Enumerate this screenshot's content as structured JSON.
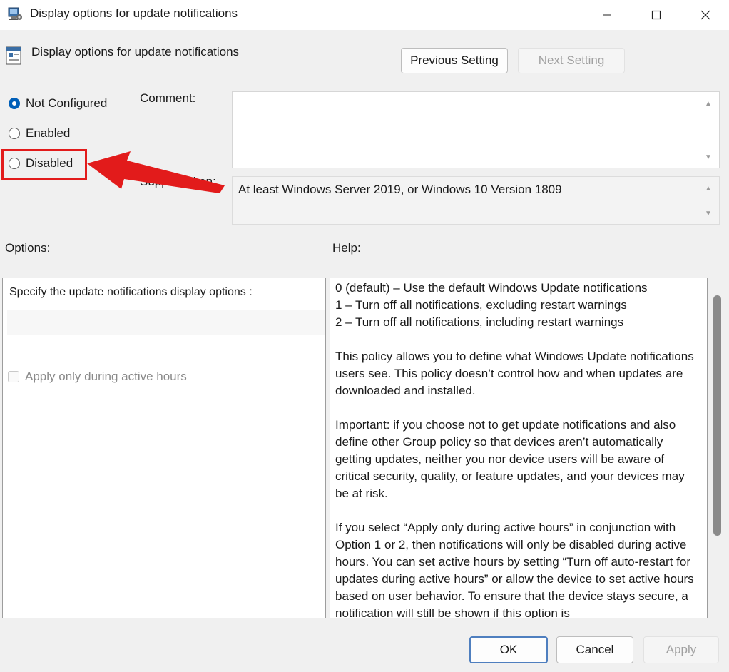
{
  "window": {
    "title": "Display options for update notifications",
    "icon": "group-policy-icon",
    "controls": {
      "minimize": "—",
      "maximize": "☐",
      "close": "✕"
    }
  },
  "header": {
    "policy_title": "Display options for update notifications",
    "previous_label": "Previous Setting",
    "next_label": "Next Setting"
  },
  "state": {
    "options": [
      {
        "label": "Not Configured",
        "checked": true
      },
      {
        "label": "Enabled",
        "checked": false
      },
      {
        "label": "Disabled",
        "checked": false
      }
    ],
    "highlight_color": "#e21b1b"
  },
  "comment": {
    "label": "Comment:",
    "value": ""
  },
  "supported": {
    "label": "Supported on:",
    "value": "At least Windows Server 2019, or Windows 10 Version 1809"
  },
  "options_panel": {
    "heading": "Options:",
    "specify_label": "Specify the update notifications display options :",
    "dropdown_value": "",
    "checkbox_label": "Apply only during active hours"
  },
  "help_panel": {
    "heading": "Help:",
    "lines": [
      "0 (default) – Use the default Windows Update notifications",
      "1 – Turn off all notifications, excluding restart warnings",
      "2 – Turn off all notifications, including restart warnings"
    ],
    "paragraphs": [
      "This policy allows you to define what Windows Update notifications users see. This policy doesn’t control how and when updates are downloaded and installed.",
      "Important: if you choose not to get update notifications and also define other Group policy so that devices aren’t automatically getting updates, neither you nor device users will be aware of critical security, quality, or feature updates, and your devices may be at risk.",
      "If you select “Apply only during active hours” in conjunction with Option 1 or 2, then notifications will only be disabled during active hours. You can set active hours by setting “Turn off auto-restart for updates during active hours” or allow the device to set active hours based on user behavior. To ensure that the device stays secure, a notification will still be shown if this option is"
    ]
  },
  "footer": {
    "ok_label": "OK",
    "cancel_label": "Cancel",
    "apply_label": "Apply"
  },
  "colors": {
    "accent": "#005fb8",
    "annotation": "#e21b1b"
  }
}
